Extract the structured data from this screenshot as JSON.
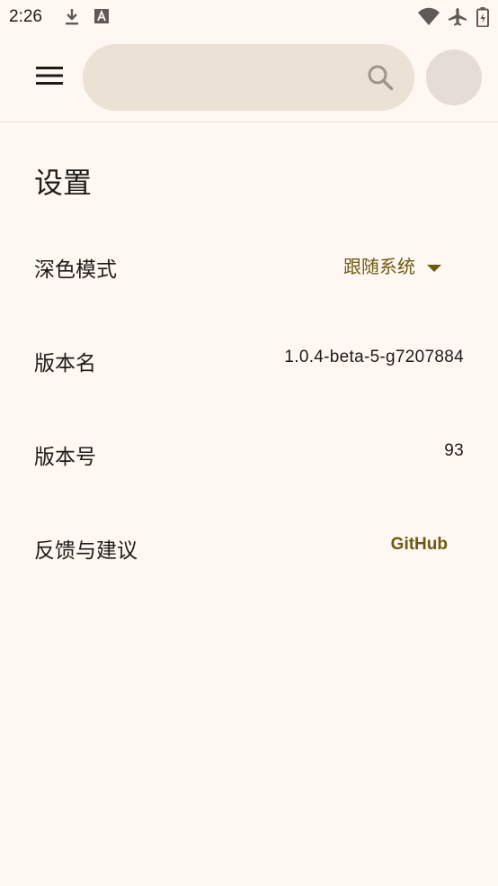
{
  "status_bar": {
    "time": "2:26",
    "icons": [
      "download-icon",
      "text-notification-icon",
      "wifi-icon",
      "airplane-mode-icon",
      "battery-icon"
    ]
  },
  "app_bar": {
    "menu_icon": "hamburger-menu-icon",
    "search_icon": "search-icon",
    "search_placeholder": ""
  },
  "settings": {
    "title": "设置",
    "dark_mode": {
      "label": "深色模式",
      "value": "跟随系统"
    },
    "version_name": {
      "label": "版本名",
      "value": "1.0.4-beta-5-g7207884"
    },
    "version_code": {
      "label": "版本号",
      "value": "93"
    },
    "feedback": {
      "label": "反馈与建议",
      "link_label": "GitHub"
    }
  },
  "colors": {
    "background": "#fff7f2",
    "search_bar": "#ebe1d5",
    "accent": "#6d5a10",
    "text": "#1f1b16"
  }
}
